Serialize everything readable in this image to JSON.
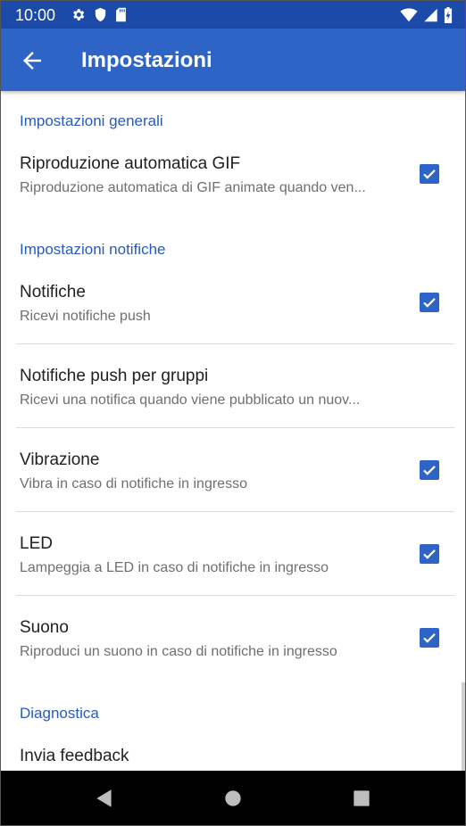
{
  "status_bar": {
    "time": "10:00"
  },
  "app_bar": {
    "title": "Impostazioni"
  },
  "sections": [
    {
      "header": "Impostazioni generali"
    },
    {
      "header": "Impostazioni notifiche"
    },
    {
      "header": "Diagnostica"
    }
  ],
  "items": [
    {
      "title": "Riproduzione automatica GIF",
      "subtitle": "Riproduzione automatica di GIF animate quando ven...",
      "checked": true
    },
    {
      "title": "Notifiche",
      "subtitle": "Ricevi notifiche push",
      "checked": true
    },
    {
      "title": "Notifiche push per gruppi",
      "subtitle": "Ricevi una notifica quando viene pubblicato un nuov..."
    },
    {
      "title": "Vibrazione",
      "subtitle": "Vibra in caso di notifiche in ingresso",
      "checked": true
    },
    {
      "title": "LED",
      "subtitle": "Lampeggia a LED in caso di notifiche in ingresso",
      "checked": true
    },
    {
      "title": "Suono",
      "subtitle": "Riproduci un suono in caso di notifiche in ingresso",
      "checked": true
    },
    {
      "title": "Invia feedback"
    }
  ],
  "colors": {
    "accent": "#2f64c7",
    "status_bar": "#1b4aa8",
    "section_header": "#2a5ab8"
  },
  "icons": {
    "status": [
      "gear-icon",
      "shield-icon",
      "sd-card-icon",
      "wifi-icon",
      "signal-icon",
      "battery-charging-icon"
    ],
    "nav": [
      "nav-back-icon",
      "nav-home-icon",
      "nav-recents-icon"
    ],
    "app_bar": "arrow-back-icon"
  }
}
